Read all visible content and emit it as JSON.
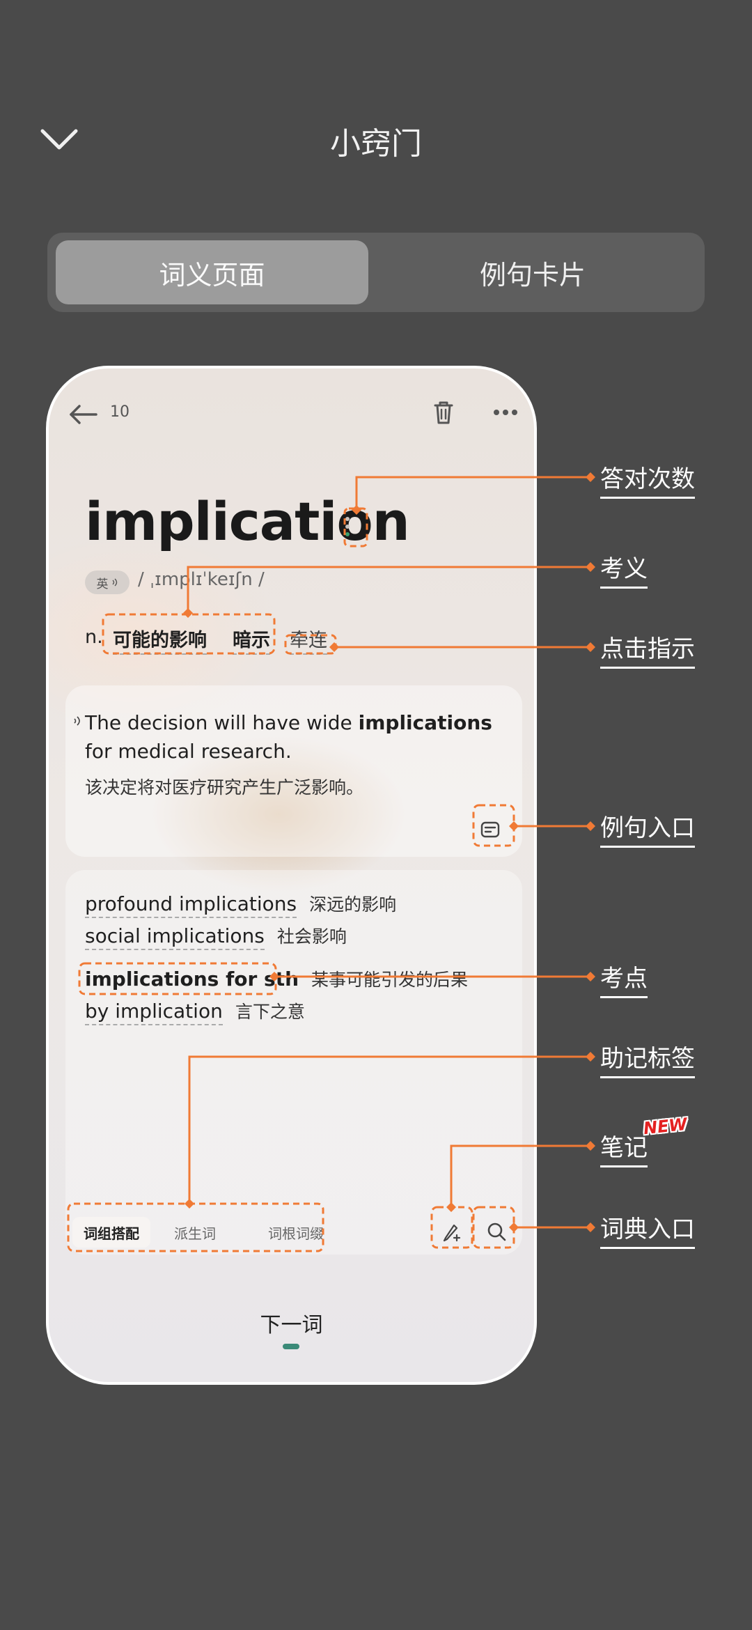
{
  "header": {
    "title": "小窍门"
  },
  "segmented": {
    "left": "词义页面",
    "right": "例句卡片",
    "selected": "词义页面"
  },
  "phone": {
    "count": "10",
    "word": "implication",
    "lang": "英",
    "phonetic": "/ ˌɪmplɪˈkeɪʃn /",
    "pos": "n.",
    "meanings": [
      "可能的影响",
      "暗示",
      "牵连"
    ],
    "example": {
      "en_before": "The decision will have wide ",
      "en_bold": "implications",
      "en_after": " for medical research.",
      "zh": "该决定将对医疗研究产生广泛影响。"
    },
    "collocations": [
      {
        "en": "profound implications",
        "zh": "深远的影响"
      },
      {
        "en": "social implications",
        "zh": "社会影响"
      },
      {
        "en": "implications for sth",
        "zh": "某事可能引发的后果"
      },
      {
        "en": "by implication",
        "zh": "言下之意"
      }
    ],
    "tabs": [
      "词组搭配",
      "派生词",
      "词根词缀"
    ],
    "next": "下一词"
  },
  "annotations": {
    "correct_count": "答对次数",
    "meaning": "考义",
    "tap_hint": "点击指示",
    "example_entry": "例句入口",
    "key_point": "考点",
    "mnemonic_tags": "助记标签",
    "notes": "笔记",
    "new_badge": "NEW",
    "dictionary_entry": "词典入口"
  },
  "colors": {
    "accent": "#f07a35",
    "background": "#4a4a4a",
    "progress_dot": "#3aa070"
  }
}
